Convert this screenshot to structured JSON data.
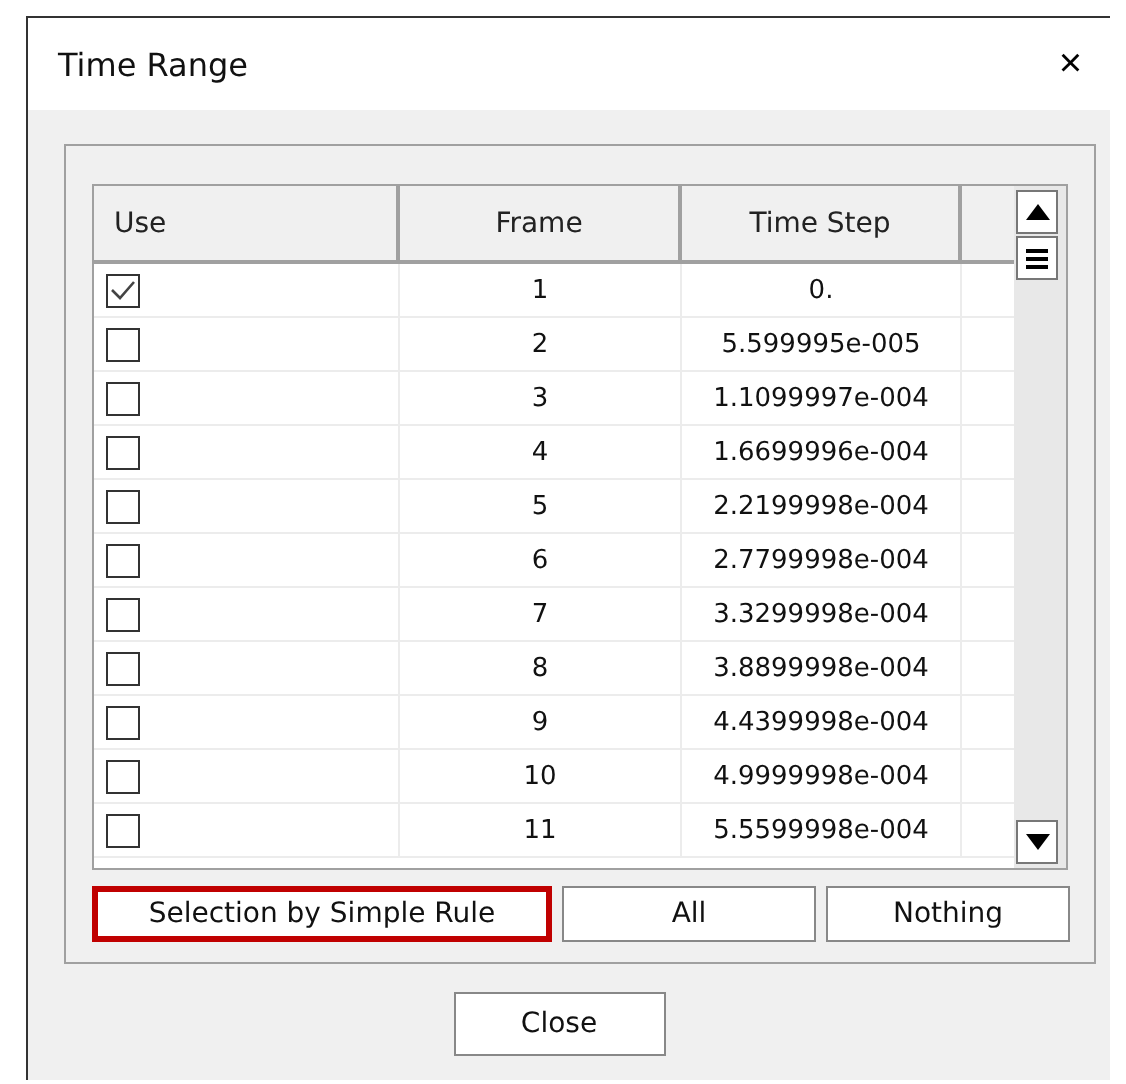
{
  "window": {
    "title": "Time Range",
    "close_label": "×"
  },
  "table": {
    "columns": [
      "Use",
      "Frame",
      "Time Step"
    ],
    "rows": [
      {
        "checked": true,
        "frame": "1",
        "time_step": "0."
      },
      {
        "checked": false,
        "frame": "2",
        "time_step": "5.599995e-005"
      },
      {
        "checked": false,
        "frame": "3",
        "time_step": "1.1099997e-004"
      },
      {
        "checked": false,
        "frame": "4",
        "time_step": "1.6699996e-004"
      },
      {
        "checked": false,
        "frame": "5",
        "time_step": "2.2199998e-004"
      },
      {
        "checked": false,
        "frame": "6",
        "time_step": "2.7799998e-004"
      },
      {
        "checked": false,
        "frame": "7",
        "time_step": "3.3299998e-004"
      },
      {
        "checked": false,
        "frame": "8",
        "time_step": "3.8899998e-004"
      },
      {
        "checked": false,
        "frame": "9",
        "time_step": "4.4399998e-004"
      },
      {
        "checked": false,
        "frame": "10",
        "time_step": "4.9999998e-004"
      },
      {
        "checked": false,
        "frame": "11",
        "time_step": "5.5599998e-004"
      }
    ]
  },
  "actions": [
    {
      "label": "Selection by Simple Rule",
      "selected": true
    },
    {
      "label": "All",
      "selected": false
    },
    {
      "label": "Nothing",
      "selected": false
    }
  ],
  "close_button": "Close"
}
